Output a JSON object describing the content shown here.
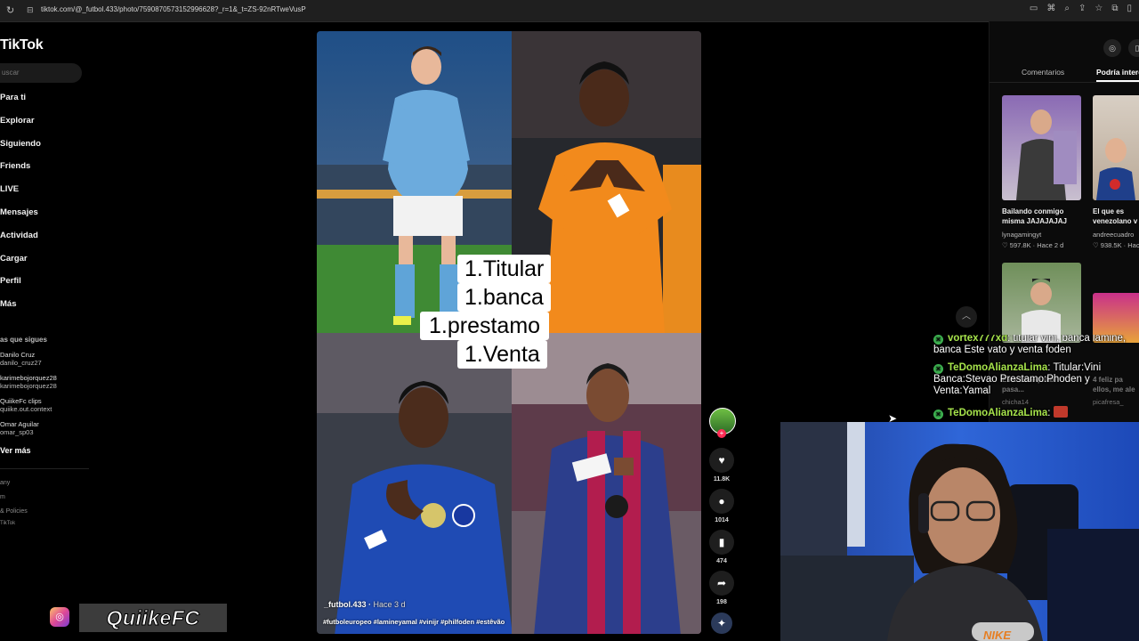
{
  "browser": {
    "url": "tiktok.com/@_futbol.433/photo/7590870573152996628?_r=1&_t=ZS-92nRTweVusP"
  },
  "nav": {
    "logo": "TikTok",
    "search_placeholder": "uscar",
    "items": [
      "Para ti",
      "Explorar",
      "Siguiendo",
      "Friends",
      "LIVE",
      "Mensajes",
      "Actividad",
      "Cargar",
      "Perfil",
      "Más"
    ],
    "following_title": "as que sigues",
    "following": [
      {
        "name": "Danilo Cruz",
        "handle": "danilo_cruz27"
      },
      {
        "name": "karimebojorquez28",
        "handle": "karimebojorquez28"
      },
      {
        "name": "QuiikeFc clips",
        "handle": "quiike.out.context"
      },
      {
        "name": "Omar Aguilar",
        "handle": "omar_sp03"
      }
    ],
    "see_more": "Ver más",
    "footer": [
      "any",
      "m",
      "& Policies",
      "TikTok"
    ]
  },
  "video": {
    "overlay_lines": [
      "1.Titular",
      "1.banca",
      "1.prestamo",
      "1.Venta"
    ],
    "author": "_futbol.433",
    "time": "Hace 3 d",
    "hashtags": "#futboleuropeo #lamineyamal #vinijr #philfoden #estêvão",
    "likes": "11.8K",
    "comments": "1014",
    "saves": "474",
    "shares": "198"
  },
  "right_panel": {
    "tab_comments": "Comentarios",
    "tab_might_like": "Podría intere",
    "cards": [
      {
        "title": "Bailando conmigo",
        "title2": "misma JAJAJAJAJ",
        "author": "lynagamingyt",
        "stats": "♡ 597.8K · Hace 2 d"
      },
      {
        "title": "El que es",
        "title2": "venezolano v",
        "author": "andreecuadro",
        "stats": "♡ 938.5K · Hace"
      },
      {
        "title": "Este desequilibr",
        "title2": "pasa...",
        "author": "chicha14",
        "stats": ""
      },
      {
        "title": "4 feliz pa",
        "title2": "ellos, me ale",
        "author": "picafresa_",
        "stats": ""
      }
    ]
  },
  "chat": [
    {
      "user": "vortex777xd",
      "text": "titular vini, banca lamine, banca Este vato y venta foden"
    },
    {
      "user": "TeDomoAlianzaLima",
      "text": "Titular:Vini Banca:Stevao Prestamo:Phoden y Venta:Yamal"
    },
    {
      "user": "TeDomoAlianzaLima",
      "text": ""
    }
  ],
  "streamer": {
    "name": "QuiikeFC",
    "shirt_text": "NIKE"
  },
  "colors": {
    "background": "#000000",
    "tiktok_red": "#fe2c55",
    "chat_user": "#a6e34b",
    "city_blue": "#6cabdd",
    "chelsea_blue": "#1f4bb4",
    "real_orange": "#f28a1c",
    "barca_blue": "#2c3e8c"
  },
  "icons": [
    "reload-icon",
    "search-icon",
    "heart-icon",
    "comment-icon",
    "bookmark-icon",
    "share-icon",
    "chevron-up-icon",
    "instagram-icon"
  ]
}
